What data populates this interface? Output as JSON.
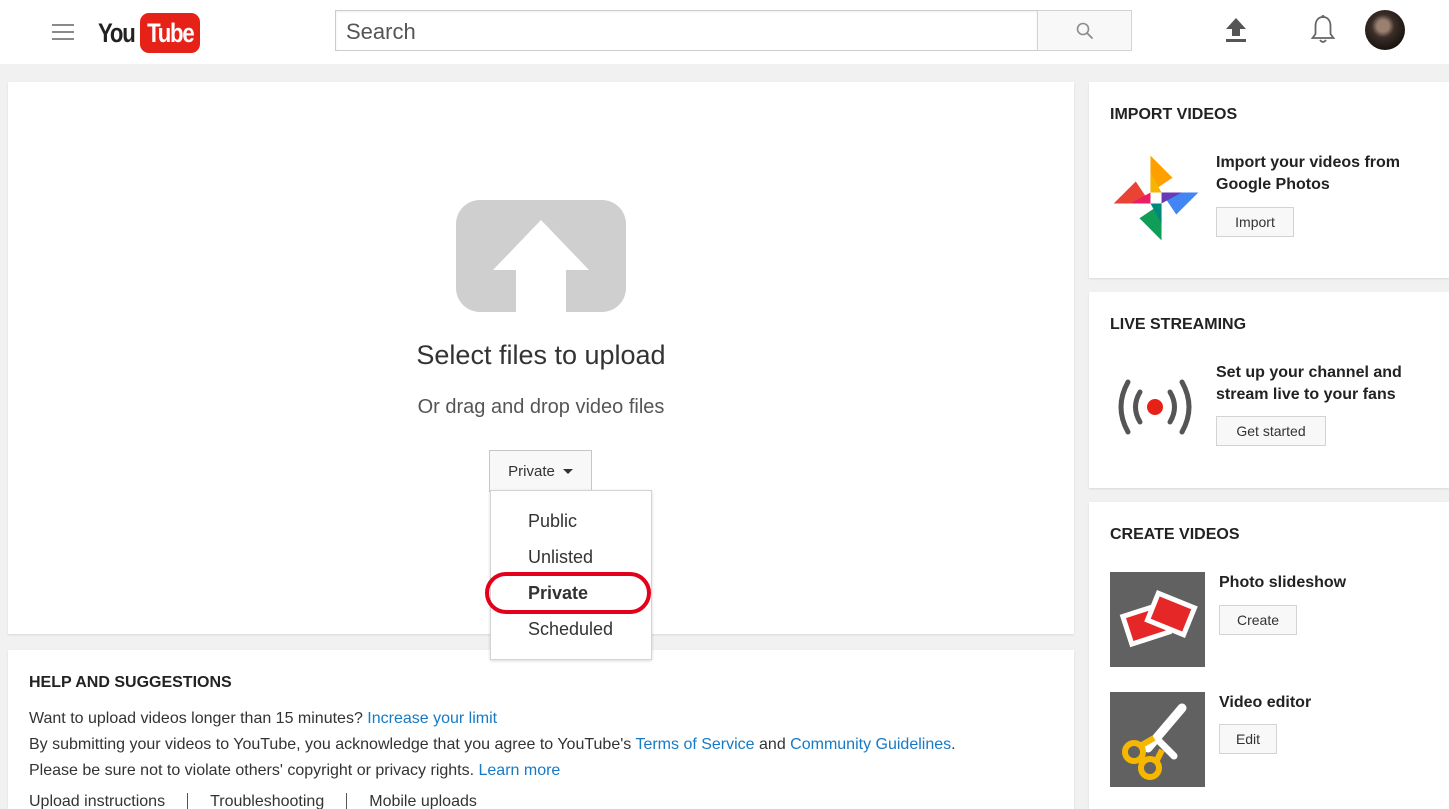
{
  "header": {
    "logo_you": "You",
    "logo_tube": "Tube",
    "search_placeholder": "Search"
  },
  "upload": {
    "title": "Select files to upload",
    "subtitle": "Or drag and drop video files",
    "privacy_selected": "Private",
    "privacy_options": [
      "Public",
      "Unlisted",
      "Private",
      "Scheduled"
    ]
  },
  "help": {
    "title": "HELP AND SUGGESTIONS",
    "line1_text": "Want to upload videos longer than 15 minutes? ",
    "line1_link": "Increase your limit",
    "line2_text": "By submitting your videos to YouTube, you acknowledge that you agree to YouTube's ",
    "line2_link1": "Terms of Service",
    "line2_and": " and ",
    "line2_link2": "Community Guidelines",
    "line2_end": ".",
    "line3_text": "Please be sure not to violate others' copyright or privacy rights. ",
    "line3_link": "Learn more",
    "links": [
      "Upload instructions",
      "Troubleshooting",
      "Mobile uploads"
    ]
  },
  "sidebar": {
    "import": {
      "title": "IMPORT VIDEOS",
      "text": "Import your videos from Google Photos",
      "button": "Import"
    },
    "live": {
      "title": "LIVE STREAMING",
      "text": "Set up your channel and stream live to your fans",
      "button": "Get started"
    },
    "create": {
      "title": "CREATE VIDEOS",
      "slideshow_label": "Photo slideshow",
      "slideshow_button": "Create",
      "editor_label": "Video editor",
      "editor_button": "Edit"
    }
  },
  "colors": {
    "brand_red": "#e62117",
    "link_blue": "#167ac6",
    "highlight_red": "#e3001b"
  }
}
